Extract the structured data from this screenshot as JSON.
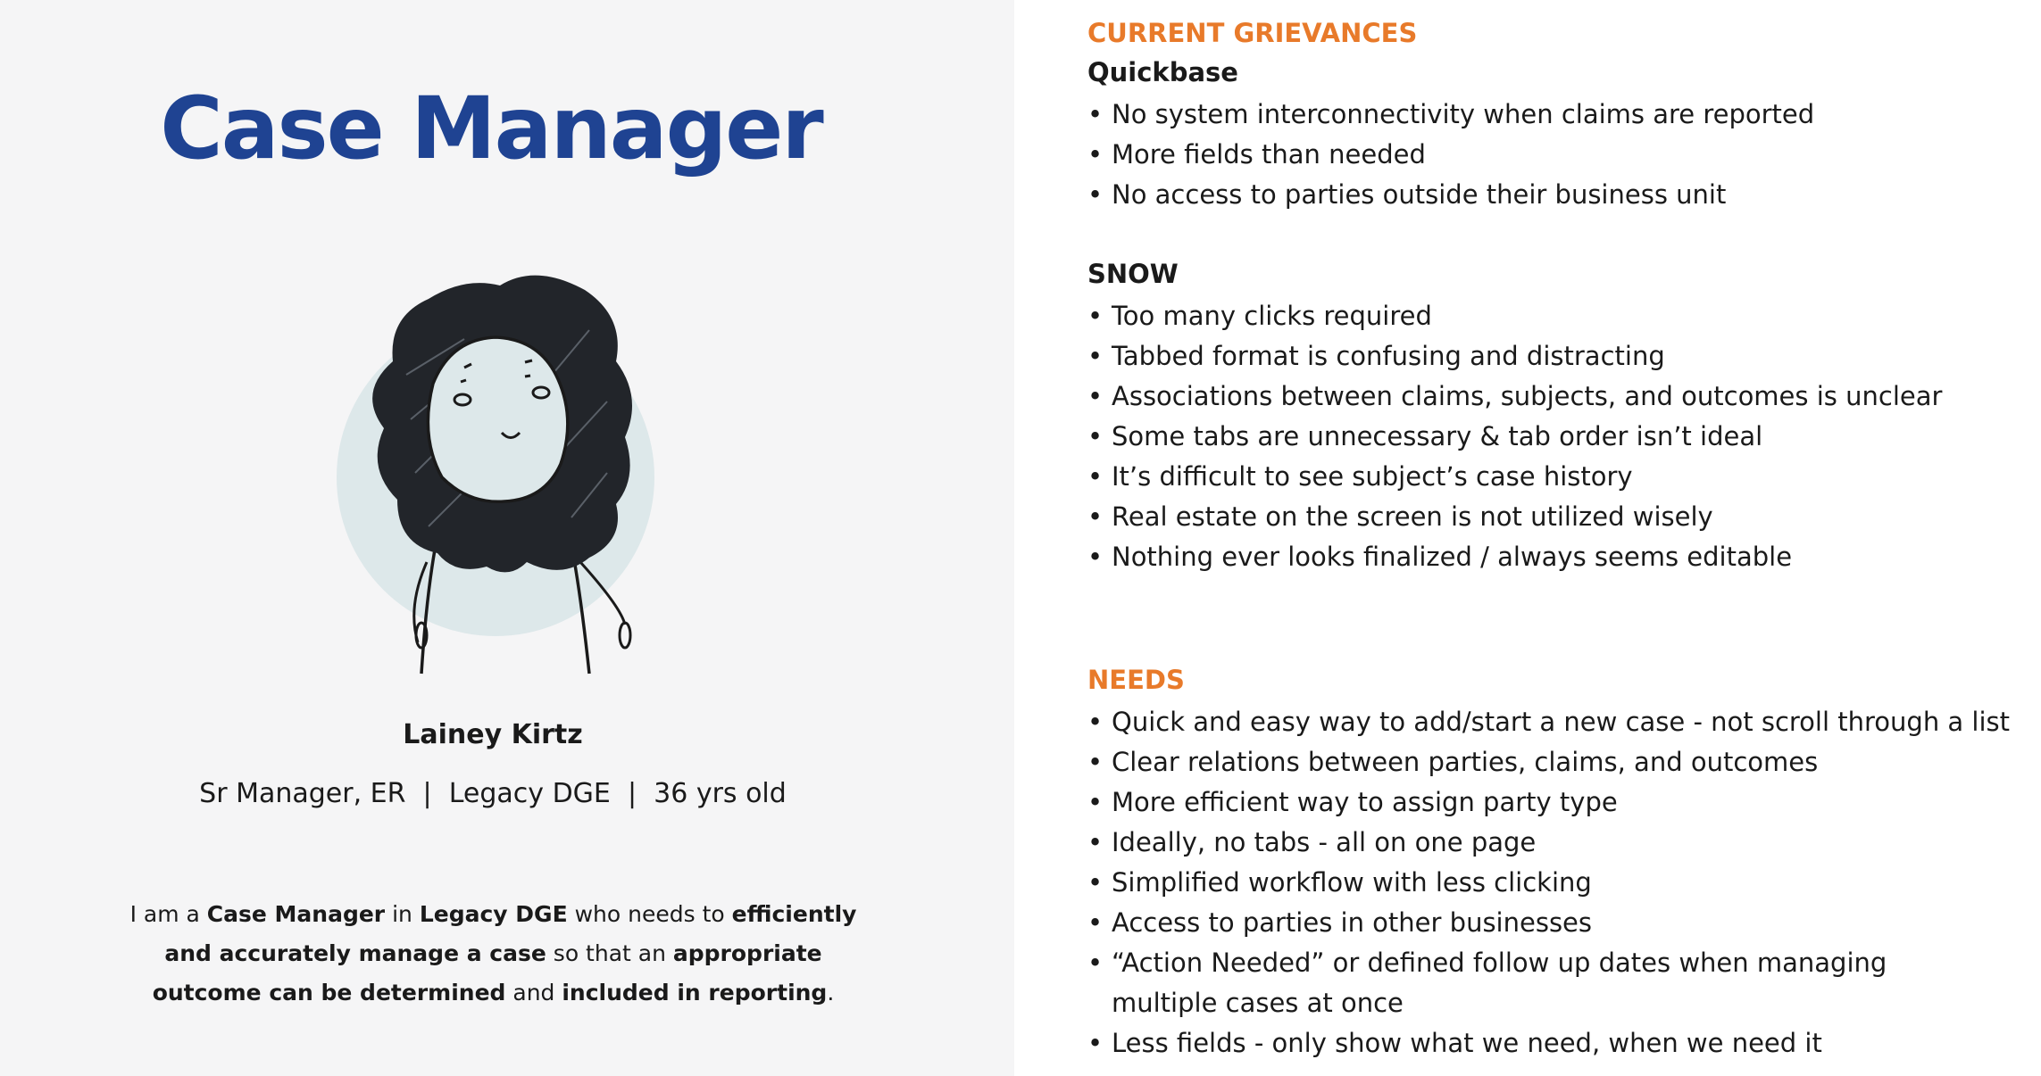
{
  "persona": {
    "title": "Case Manager",
    "name": "Lainey Kirtz",
    "meta": "Sr Manager, ER  |  Legacy DGE  |  36 yrs old",
    "statement": [
      {
        "text": "I am a ",
        "bold": false
      },
      {
        "text": "Case Manager",
        "bold": true
      },
      {
        "text": " in ",
        "bold": false
      },
      {
        "text": "Legacy DGE",
        "bold": true
      },
      {
        "text": " who needs to ",
        "bold": false
      },
      {
        "text": "efficiently and accurately manage a case",
        "bold": true
      },
      {
        "text": " so that an ",
        "bold": false
      },
      {
        "text": "appropriate outcome can be determined",
        "bold": true
      },
      {
        "text": " and ",
        "bold": false
      },
      {
        "text": "included in reporting",
        "bold": true
      },
      {
        "text": ".",
        "bold": false
      }
    ],
    "avatar_icon": "woman-avatar-icon"
  },
  "grievances": {
    "heading": "CURRENT GRIEVANCES",
    "quickbase": {
      "label": "Quickbase",
      "items": [
        "No system interconnectivity when claims are reported",
        "More fields than needed",
        "No access to parties outside their business unit"
      ]
    },
    "snow": {
      "label": "SNOW",
      "items": [
        "Too many clicks required",
        "Tabbed format is confusing and distracting",
        "Associations between claims, subjects, and outcomes is unclear",
        "Some tabs are unnecessary & tab order isn’t ideal",
        "It’s difficult to see subject’s case history",
        "Real estate on the screen is not utilized wisely",
        "Nothing ever looks finalized / always seems editable"
      ]
    }
  },
  "needs": {
    "heading": "NEEDS",
    "items": [
      "Quick and easy way to add/start a new case - not scroll through a list",
      "Clear relations between parties, claims, and outcomes",
      "More efficient way to assign party type",
      "Ideally, no tabs - all on one page",
      "Simplified workflow with less clicking",
      "Access to parties in other businesses",
      "“Action Needed” or defined follow up dates when managing multiple cases at once",
      "Less fields - only show what we need, when we need it"
    ]
  },
  "colors": {
    "title_blue": "#1f4392",
    "heading_orange": "#e87a2a",
    "panel_gray": "#f5f5f6",
    "avatar_circle": "#dde8ea"
  },
  "bullet_glyph": "•"
}
